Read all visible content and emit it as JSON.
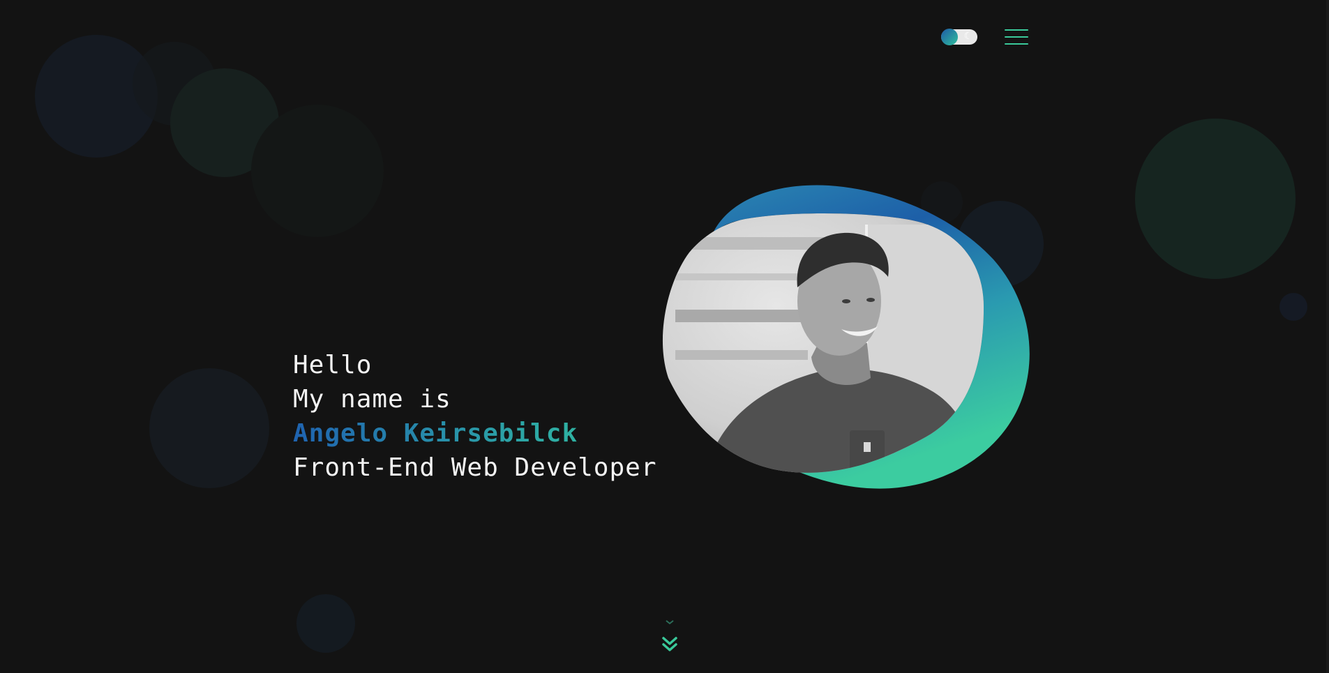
{
  "theme": {
    "accent_blue": "#1f63b0",
    "accent_teal": "#33c29d",
    "background": "#131313",
    "text": "#f4f4f4"
  },
  "header": {
    "theme_toggle_icon": "moon-icon",
    "menu_icon": "hamburger-menu-icon"
  },
  "hero": {
    "greeting": "Hello",
    "intro": "My name is",
    "name": "Angelo Keirsebilck",
    "role": "Front-End Web Developer"
  },
  "scroll_hint_icon": "double-chevron-down-icon"
}
